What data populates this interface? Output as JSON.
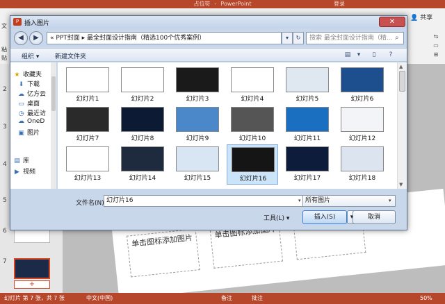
{
  "ppt": {
    "doc_title": "占位符",
    "app_name": "PowerPoint",
    "login": "登录",
    "share": "共享",
    "ribbon_left": [
      "文",
      "粘",
      "贴"
    ],
    "slide_numbers": [
      "1",
      "2",
      "3",
      "4",
      "5",
      "6",
      "7"
    ],
    "placeholder_text": "单击图标添加图片",
    "status": {
      "slide_info": "幻灯片 第 7 张，共 7 张",
      "language": "中文(中国)",
      "notes": "备注",
      "comments": "批注",
      "zoom": "50%"
    }
  },
  "dialog": {
    "title": "插入图片",
    "address_path": [
      "PPT封面",
      "最全封面设计指南（精选100个优秀案例）"
    ],
    "search_placeholder": "搜索 最全封面设计指南（精...",
    "toolbar": {
      "organize": "组织 ▾",
      "new_folder": "新建文件夹"
    },
    "nav_items": [
      {
        "icon": "star-icon",
        "label": "收藏夹"
      },
      {
        "icon": "download-icon",
        "label": "下载"
      },
      {
        "icon": "cloud-icon",
        "label": "亿方云"
      },
      {
        "icon": "desktop-icon",
        "label": "桌面"
      },
      {
        "icon": "recent-icon",
        "label": "最近访"
      },
      {
        "icon": "onedrive-icon",
        "label": "OneD"
      },
      {
        "icon": "picture-icon",
        "label": "图片"
      },
      {
        "icon": "library-icon",
        "label": "库"
      },
      {
        "icon": "video-icon",
        "label": "视频"
      }
    ],
    "files": [
      {
        "label": "幻灯片1",
        "bg": "#ffffff"
      },
      {
        "label": "幻灯片2",
        "bg": "#ffffff"
      },
      {
        "label": "幻灯片3",
        "bg": "#1a1a1a"
      },
      {
        "label": "幻灯片4",
        "bg": "#ffffff"
      },
      {
        "label": "幻灯片5",
        "bg": "#dfe7f0"
      },
      {
        "label": "幻灯片6",
        "bg": "#1d4f8f"
      },
      {
        "label": "幻灯片7",
        "bg": "#2a2a2a"
      },
      {
        "label": "幻灯片8",
        "bg": "#0d1a33"
      },
      {
        "label": "幻灯片9",
        "bg": "#4b88c9"
      },
      {
        "label": "幻灯片10",
        "bg": "#555555"
      },
      {
        "label": "幻灯片11",
        "bg": "#1b6fc0"
      },
      {
        "label": "幻灯片12",
        "bg": "#f2f4f8"
      },
      {
        "label": "幻灯片13",
        "bg": "#ffffff"
      },
      {
        "label": "幻灯片14",
        "bg": "#1e2a3e"
      },
      {
        "label": "幻灯片15",
        "bg": "#d8e6f3"
      },
      {
        "label": "幻灯片16",
        "bg": "#151515"
      },
      {
        "label": "幻灯片17",
        "bg": "#0d1c3a"
      },
      {
        "label": "幻灯片18",
        "bg": "#dbe4ef"
      }
    ],
    "selected_label": "幻灯片16",
    "filename_label": "文件名(N):",
    "filename_value": "幻灯片16",
    "filetype_value": "所有图片",
    "tools_label": "工具(L)",
    "insert_label": "插入(S)",
    "cancel_label": "取消"
  }
}
